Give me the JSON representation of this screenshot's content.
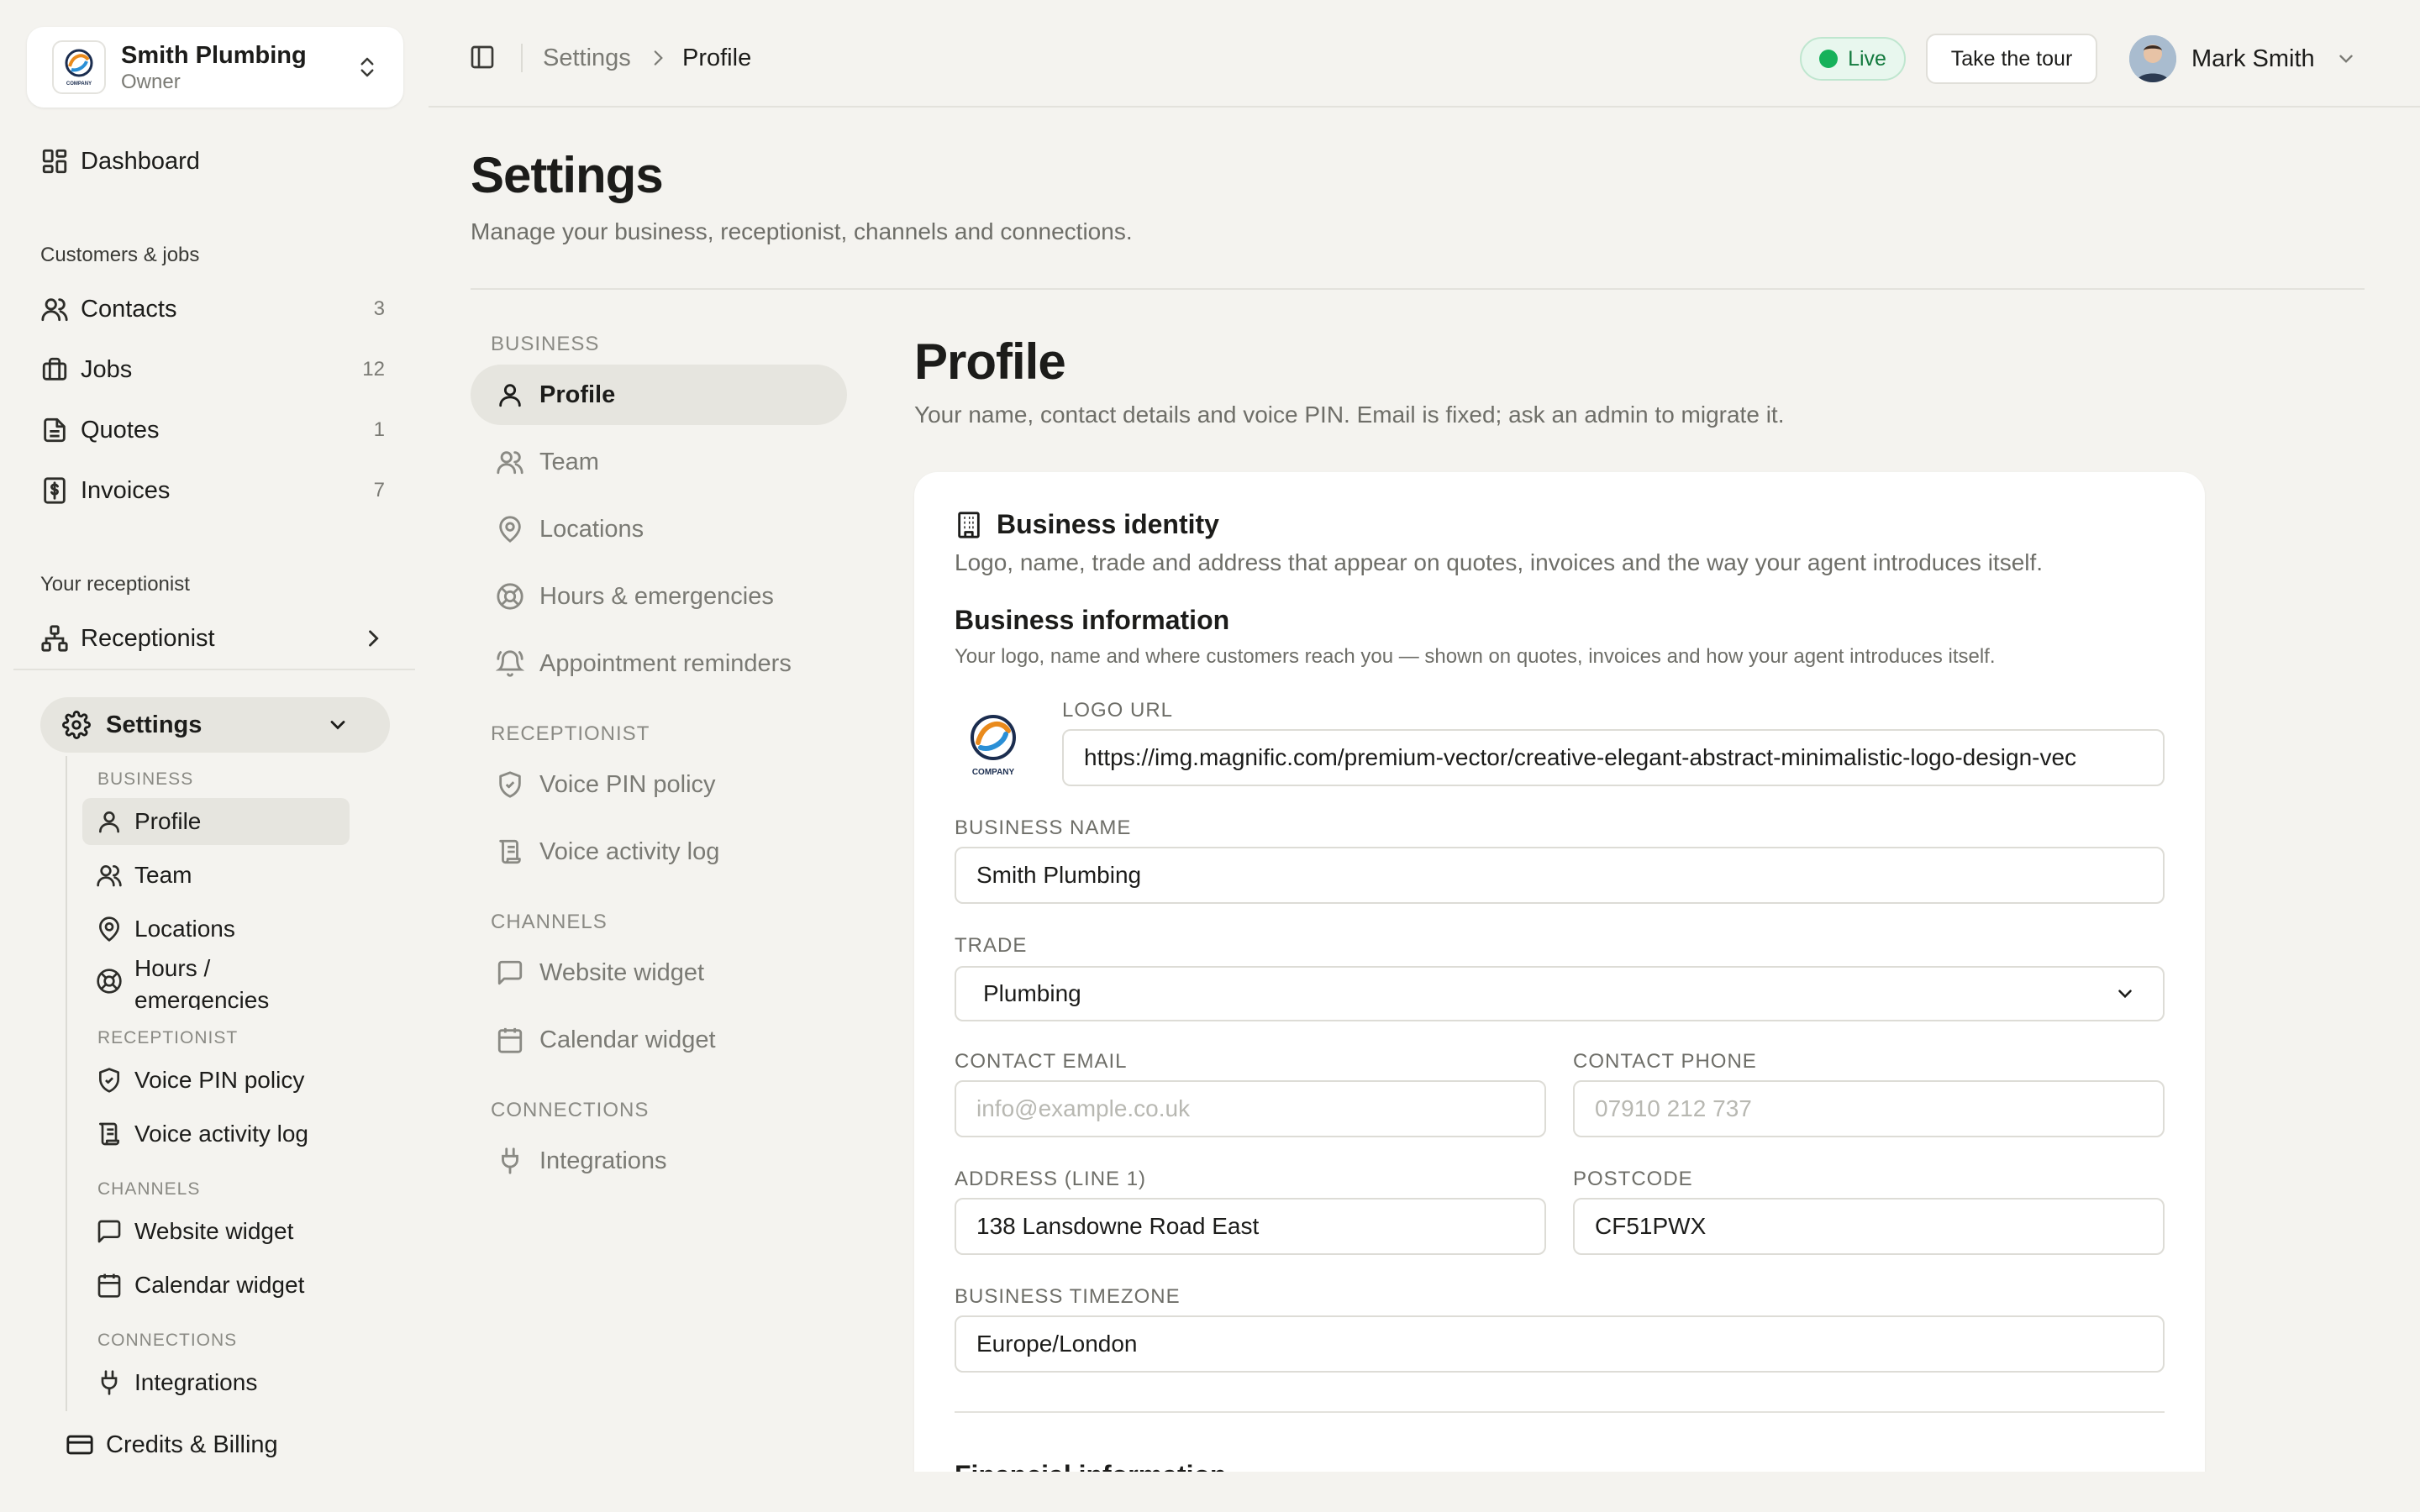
{
  "org": {
    "name": "Smith Plumbing",
    "role": "Owner"
  },
  "sidebar": {
    "dashboard": "Dashboard",
    "section_customers": "Customers & jobs",
    "contacts": {
      "label": "Contacts",
      "count": "3"
    },
    "jobs": {
      "label": "Jobs",
      "count": "12"
    },
    "quotes": {
      "label": "Quotes",
      "count": "1"
    },
    "invoices": {
      "label": "Invoices",
      "count": "7"
    },
    "section_receptionist": "Your receptionist",
    "receptionist": "Receptionist",
    "settings": "Settings",
    "sub": {
      "business": "BUSINESS",
      "profile": "Profile",
      "team": "Team",
      "locations": "Locations",
      "hours": "Hours / emergencies",
      "receptionist": "RECEPTIONIST",
      "voice_pin": "Voice PIN policy",
      "voice_log": "Voice activity log",
      "channels": "CHANNELS",
      "website_widget": "Website widget",
      "calendar_widget": "Calendar widget",
      "connections": "CONNECTIONS",
      "integrations": "Integrations"
    },
    "billing": "Credits & Billing"
  },
  "topbar": {
    "breadcrumb_1": "Settings",
    "breadcrumb_2": "Profile",
    "live": "Live",
    "tour": "Take the tour",
    "user": "Mark Smith"
  },
  "page": {
    "title": "Settings",
    "subtitle": "Manage your business, receptionist, channels and connections."
  },
  "settings_nav": {
    "business": "BUSINESS",
    "profile": "Profile",
    "team": "Team",
    "locations": "Locations",
    "hours": "Hours & emergencies",
    "reminders": "Appointment reminders",
    "receptionist": "RECEPTIONIST",
    "voice_pin": "Voice PIN policy",
    "voice_log": "Voice activity log",
    "channels": "CHANNELS",
    "website_widget": "Website widget",
    "calendar_widget": "Calendar widget",
    "connections": "CONNECTIONS",
    "integrations": "Integrations"
  },
  "profile": {
    "title": "Profile",
    "subtitle": "Your name, contact details and voice PIN. Email is fixed; ask an admin to migrate it.",
    "card_title": "Business identity",
    "card_sub": "Logo, name, trade and address that appear on quotes, invoices and the way your agent introduces itself.",
    "section_title": "Business information",
    "section_sub": "Your logo, name and where customers reach you — shown on quotes, invoices and how your agent introduces itself.",
    "logo_url": {
      "label": "LOGO URL",
      "value": "https://img.magnific.com/premium-vector/creative-elegant-abstract-minimalistic-logo-design-vec"
    },
    "business_name": {
      "label": "BUSINESS NAME",
      "value": "Smith Plumbing"
    },
    "trade": {
      "label": "TRADE",
      "value": "Plumbing"
    },
    "contact_email": {
      "label": "CONTACT EMAIL",
      "placeholder": "info@example.co.uk"
    },
    "contact_phone": {
      "label": "CONTACT PHONE",
      "placeholder": "07910 212 737"
    },
    "address": {
      "label": "ADDRESS (LINE 1)",
      "value": "138 Lansdowne Road East"
    },
    "postcode": {
      "label": "POSTCODE",
      "value": "CF51PWX"
    },
    "timezone": {
      "label": "BUSINESS TIMEZONE",
      "value": "Europe/London"
    },
    "next_section": "Financial information"
  },
  "logo_text": "COMPANY",
  "colors": {
    "background": "#f4f3ef",
    "live_green": "#16b15a",
    "active_pill": "#e6e5df"
  }
}
